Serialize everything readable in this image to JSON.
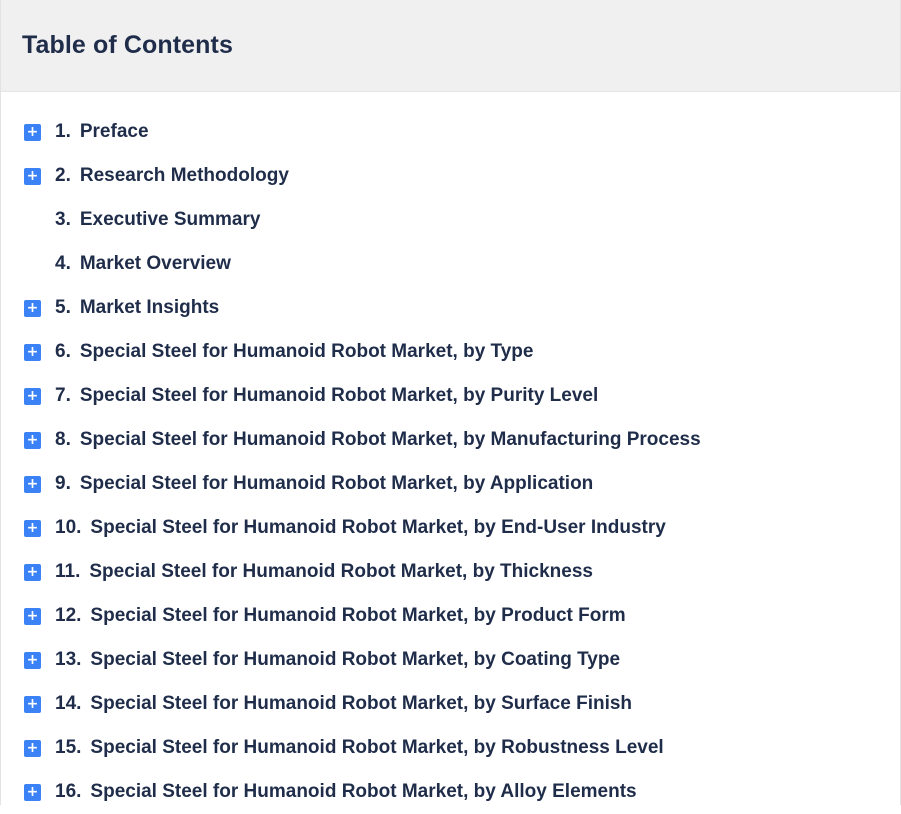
{
  "toc": {
    "title": "Table of Contents",
    "items": [
      {
        "num": "1.",
        "label": "Preface",
        "expandable": true
      },
      {
        "num": "2.",
        "label": "Research Methodology",
        "expandable": true
      },
      {
        "num": "3.",
        "label": "Executive Summary",
        "expandable": false
      },
      {
        "num": "4.",
        "label": "Market Overview",
        "expandable": false
      },
      {
        "num": "5.",
        "label": "Market Insights",
        "expandable": true
      },
      {
        "num": "6.",
        "label": "Special Steel for Humanoid Robot Market, by Type",
        "expandable": true
      },
      {
        "num": "7.",
        "label": "Special Steel for Humanoid Robot Market, by Purity Level",
        "expandable": true
      },
      {
        "num": "8.",
        "label": "Special Steel for Humanoid Robot Market, by Manufacturing Process",
        "expandable": true
      },
      {
        "num": "9.",
        "label": "Special Steel for Humanoid Robot Market, by Application",
        "expandable": true
      },
      {
        "num": "10.",
        "label": "Special Steel for Humanoid Robot Market, by End-User Industry",
        "expandable": true
      },
      {
        "num": "11.",
        "label": "Special Steel for Humanoid Robot Market, by Thickness",
        "expandable": true
      },
      {
        "num": "12.",
        "label": "Special Steel for Humanoid Robot Market, by Product Form",
        "expandable": true
      },
      {
        "num": "13.",
        "label": "Special Steel for Humanoid Robot Market, by Coating Type",
        "expandable": true
      },
      {
        "num": "14.",
        "label": "Special Steel for Humanoid Robot Market, by Surface Finish",
        "expandable": true
      },
      {
        "num": "15.",
        "label": "Special Steel for Humanoid Robot Market, by Robustness Level",
        "expandable": true
      },
      {
        "num": "16.",
        "label": "Special Steel for Humanoid Robot Market, by Alloy Elements",
        "expandable": true
      }
    ],
    "expand_glyph": "+",
    "icon_name": "plus-square-icon",
    "accent_color": "#3b82f6",
    "text_color": "#1f2d4a",
    "header_bg": "#f0f0f0"
  }
}
